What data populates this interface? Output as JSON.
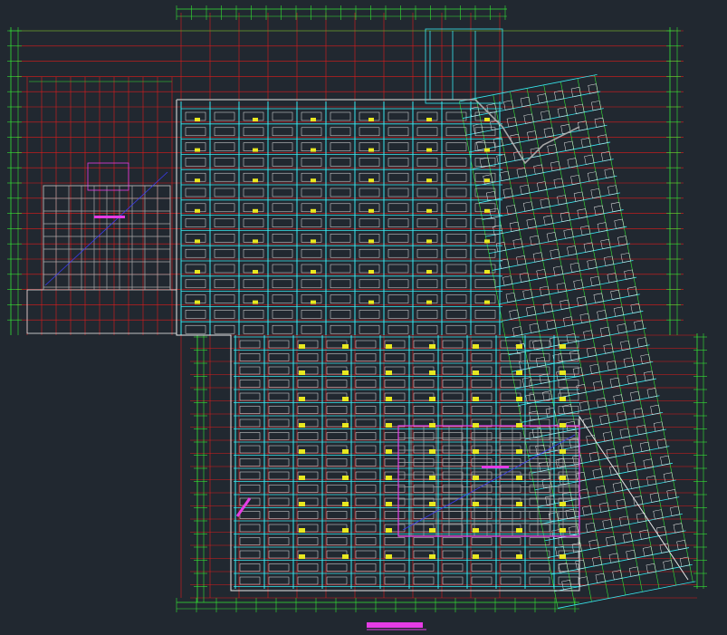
{
  "drawing": {
    "sheet_title": "",
    "colors": {
      "background": "#212830",
      "grid_red": "#e01b1b",
      "dimension_green": "#35e635",
      "beam_cyan": "#38e8f0",
      "wall_white": "#e8e8e8",
      "structure_gray": "#a8a8a8",
      "highlight_magenta": "#e63ce6",
      "tag_yellow": "#e8e820",
      "hatch_blue": "#3c3cf0"
    },
    "layers": [
      "axis-grid",
      "dimension-lines",
      "beams",
      "walls",
      "tower-core",
      "annotations"
    ]
  }
}
